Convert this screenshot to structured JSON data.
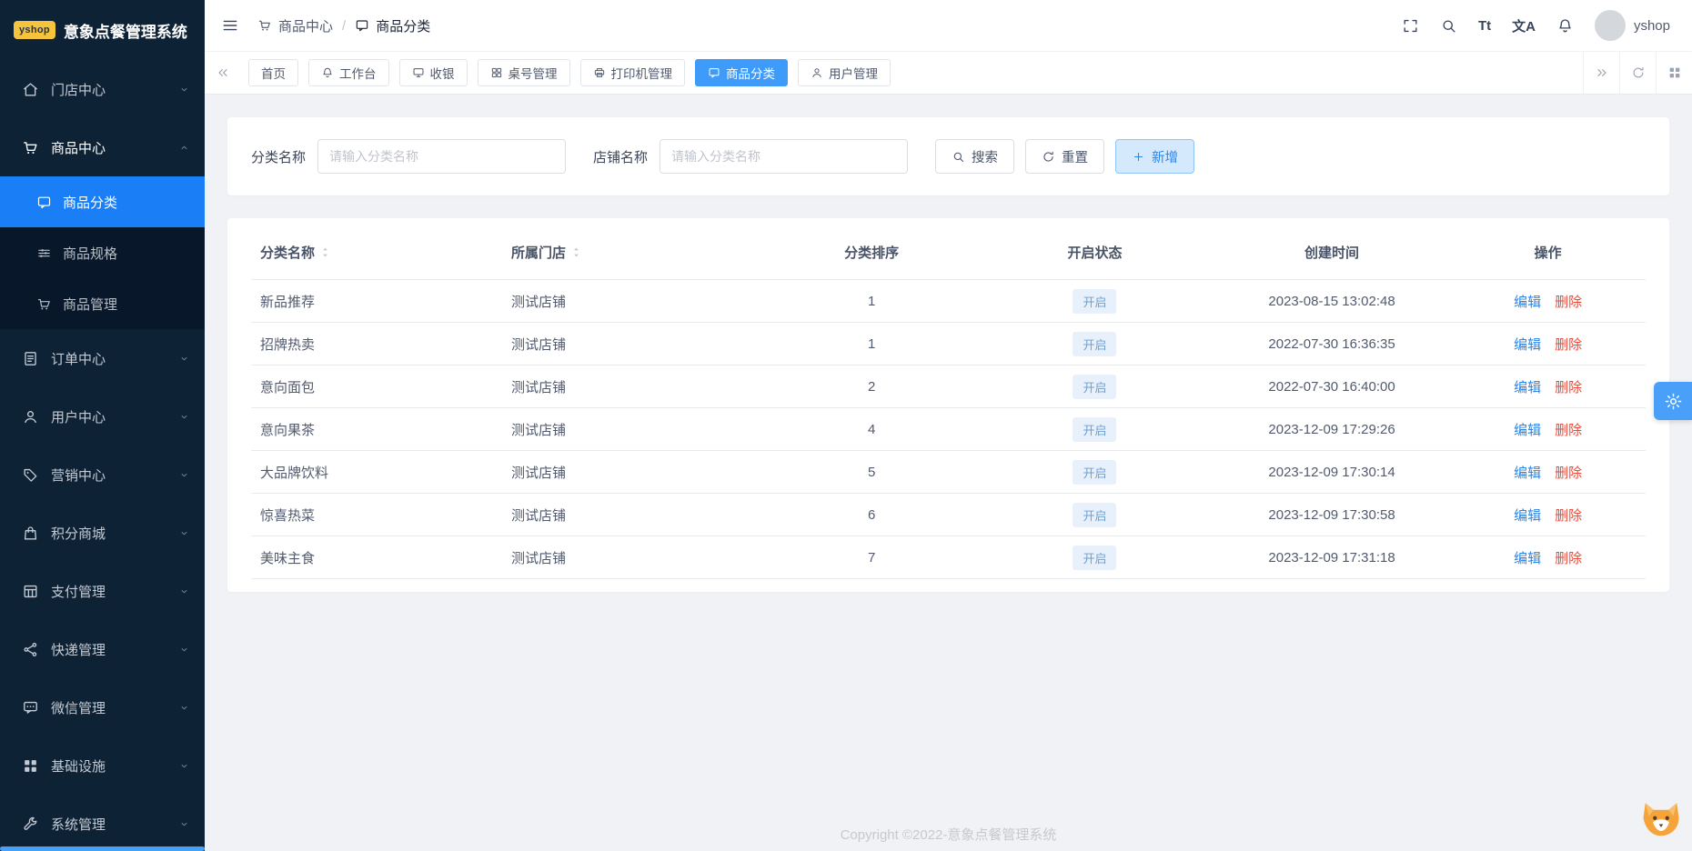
{
  "app": {
    "logo_text": "yshop",
    "title": "意象点餐管理系统"
  },
  "header": {
    "breadcrumb": [
      {
        "label": "商品中心",
        "icon": "cart-icon"
      },
      {
        "label": "商品分类",
        "icon": "chat-icon"
      }
    ],
    "separator": "/",
    "font_size_icon_text": "Tt",
    "translate_icon_text": "文A",
    "username": "yshop"
  },
  "sidebar": {
    "items": [
      {
        "key": "store-center",
        "label": "门店中心",
        "icon": "home-icon",
        "has_children": true
      },
      {
        "key": "product-center",
        "label": "商品中心",
        "icon": "cart-icon",
        "has_children": true,
        "expanded": true,
        "children": [
          {
            "key": "product-category",
            "label": "商品分类",
            "icon": "chat-icon",
            "active": true
          },
          {
            "key": "product-spec",
            "label": "商品规格",
            "icon": "sliders-icon"
          },
          {
            "key": "product-manage",
            "label": "商品管理",
            "icon": "cart-icon"
          }
        ]
      },
      {
        "key": "order-center",
        "label": "订单中心",
        "icon": "document-icon",
        "has_children": true
      },
      {
        "key": "user-center",
        "label": "用户中心",
        "icon": "user-icon",
        "has_children": true
      },
      {
        "key": "marketing-center",
        "label": "营销中心",
        "icon": "tag-icon",
        "has_children": true
      },
      {
        "key": "points-mall",
        "label": "积分商城",
        "icon": "bag-icon",
        "has_children": true
      },
      {
        "key": "payment-manage",
        "label": "支付管理",
        "icon": "table-icon",
        "has_children": true
      },
      {
        "key": "express-manage",
        "label": "快递管理",
        "icon": "share-icon",
        "has_children": true
      },
      {
        "key": "wechat-manage",
        "label": "微信管理",
        "icon": "message-icon",
        "has_children": true
      },
      {
        "key": "infrastructure",
        "label": "基础设施",
        "icon": "apps-icon",
        "has_children": true
      },
      {
        "key": "system-manage",
        "label": "系统管理",
        "icon": "wrench-icon",
        "has_children": true
      }
    ]
  },
  "tabbar": {
    "tabs": [
      {
        "key": "home",
        "label": "首页",
        "icon": null
      },
      {
        "key": "workbench",
        "label": "工作台",
        "icon": "bell-icon"
      },
      {
        "key": "cashier",
        "label": "收银",
        "icon": "monitor-icon"
      },
      {
        "key": "table-manage",
        "label": "桌号管理",
        "icon": "grid-icon"
      },
      {
        "key": "printer-manage",
        "label": "打印机管理",
        "icon": "printer-icon"
      },
      {
        "key": "product-category",
        "label": "商品分类",
        "icon": "chat-icon",
        "active": true
      },
      {
        "key": "user-manage",
        "label": "用户管理",
        "icon": "user-icon"
      }
    ]
  },
  "filters": {
    "fields": [
      {
        "label": "分类名称",
        "placeholder": "请输入分类名称",
        "value": ""
      },
      {
        "label": "店铺名称",
        "placeholder": "请输入分类名称",
        "value": ""
      }
    ],
    "search_label": "搜索",
    "reset_label": "重置",
    "add_label": "新增"
  },
  "table": {
    "headers": [
      {
        "label": "分类名称",
        "sortable": true,
        "align": "left"
      },
      {
        "label": "所属门店",
        "sortable": true,
        "align": "left"
      },
      {
        "label": "分类排序",
        "sortable": false,
        "align": "center"
      },
      {
        "label": "开启状态",
        "sortable": false,
        "align": "center"
      },
      {
        "label": "创建时间",
        "sortable": false,
        "align": "center"
      },
      {
        "label": "操作",
        "sortable": false,
        "align": "center"
      }
    ],
    "rows": [
      {
        "name": "新品推荐",
        "store": "测试店铺",
        "sort": "1",
        "status": "开启",
        "created": "2023-08-15 13:02:48"
      },
      {
        "name": "招牌热卖",
        "store": "测试店铺",
        "sort": "1",
        "status": "开启",
        "created": "2022-07-30 16:36:35"
      },
      {
        "name": "意向面包",
        "store": "测试店铺",
        "sort": "2",
        "status": "开启",
        "created": "2022-07-30 16:40:00"
      },
      {
        "name": "意向果茶",
        "store": "测试店铺",
        "sort": "4",
        "status": "开启",
        "created": "2023-12-09 17:29:26"
      },
      {
        "name": "大品牌饮料",
        "store": "测试店铺",
        "sort": "5",
        "status": "开启",
        "created": "2023-12-09 17:30:14"
      },
      {
        "name": "惊喜热菜",
        "store": "测试店铺",
        "sort": "6",
        "status": "开启",
        "created": "2023-12-09 17:30:58"
      },
      {
        "name": "美味主食",
        "store": "测试店铺",
        "sort": "7",
        "status": "开启",
        "created": "2023-12-09 17:31:18"
      }
    ],
    "edit_label": "编辑",
    "delete_label": "删除"
  },
  "footer": {
    "copyright": "Copyright ©2022-意象点餐管理系统"
  },
  "colors": {
    "primary": "#3f9bfa",
    "sidebar_bg": "#0e2236",
    "active_menu_bg": "#1a7ff6",
    "link_blue": "#2b85e4",
    "danger_red": "#ed4a3b",
    "status_badge_bg": "#e8f1fb",
    "status_badge_text": "#6fa0d2",
    "logo_badge_bg": "#f6c33d"
  }
}
